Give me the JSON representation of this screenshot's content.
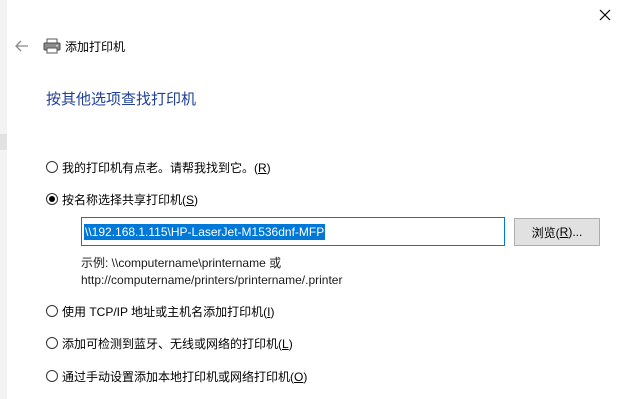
{
  "window": {
    "title": "添加打印机",
    "close_icon": "close-icon",
    "back_icon": "back-arrow-icon",
    "printer_icon": "printer-icon"
  },
  "heading": "按其他选项查找打印机",
  "options": [
    {
      "label": "我的打印机有点老。请帮我找到它。(",
      "key": "R",
      "tail": ")",
      "checked": false
    },
    {
      "label": "按名称选择共享打印机(",
      "key": "S",
      "tail": ")",
      "checked": true
    },
    {
      "label": "使用 TCP/IP 地址或主机名添加打印机(",
      "key": "I",
      "tail": ")",
      "checked": false
    },
    {
      "label": "添加可检测到蓝牙、无线或网络的打印机(",
      "key": "L",
      "tail": ")",
      "checked": false
    },
    {
      "label": "通过手动设置添加本地打印机或网络打印机(",
      "key": "O",
      "tail": ")",
      "checked": false
    }
  ],
  "shared_printer": {
    "value": "\\\\192.168.1.115\\HP-LaserJet-M1536dnf-MFP",
    "browse_pre": "浏览(",
    "browse_key": "R",
    "browse_post": ")...",
    "example_line1": "示例: \\\\computername\\printername 或",
    "example_line2": "http://computername/printers/printername/.printer"
  },
  "colors": {
    "heading": "#1f3f99",
    "selection": "#0078d7"
  }
}
